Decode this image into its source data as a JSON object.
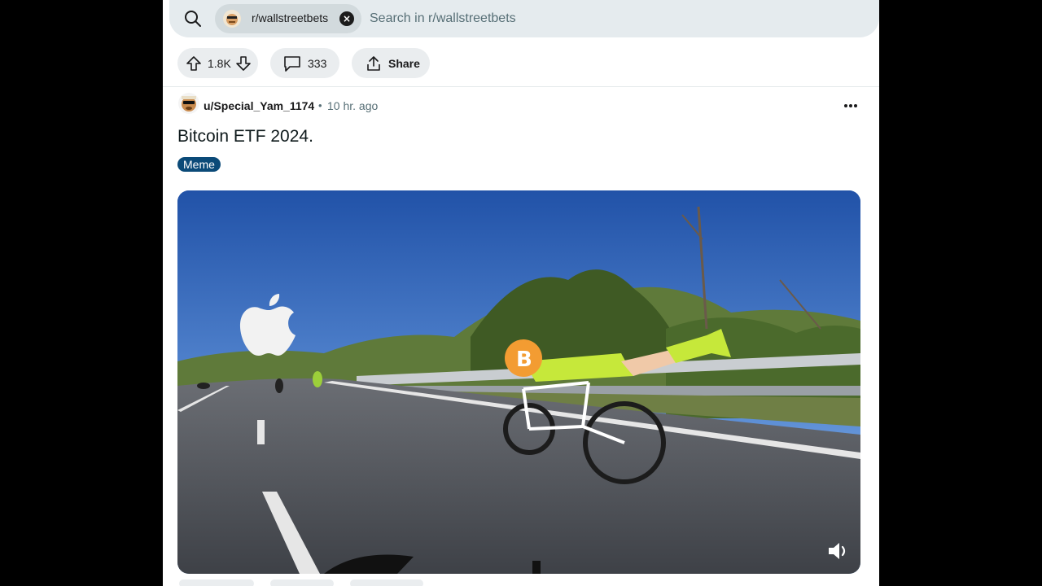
{
  "search": {
    "subreddit_chip": "r/wallstreetbets",
    "placeholder": "Search in r/wallstreetbets"
  },
  "actions": {
    "votes": "1.8K",
    "comments": "333",
    "share": "Share"
  },
  "post": {
    "author": "u/Special_Yam_1174",
    "separator": "•",
    "time": "10 hr. ago",
    "title": "Bitcoin ETF 2024.",
    "flair": "Meme"
  },
  "colors": {
    "flair_bg": "#0b4a78",
    "pill_bg": "#eaedef",
    "search_bg": "#e5ebee"
  },
  "icons": [
    "search-icon",
    "close-icon",
    "upvote-icon",
    "downvote-icon",
    "comment-icon",
    "share-icon",
    "more-icon",
    "volume-icon",
    "apple-logo",
    "bitcoin-logo"
  ]
}
